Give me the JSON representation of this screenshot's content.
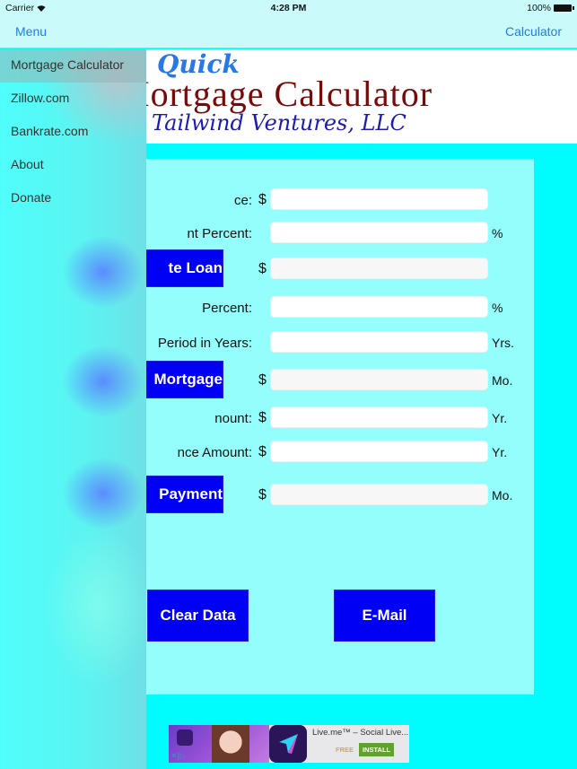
{
  "status_bar": {
    "carrier": "Carrier",
    "time": "4:28 PM",
    "battery": "100%"
  },
  "nav": {
    "left_label": "Menu",
    "right_label": "Calculator"
  },
  "banner": {
    "line1": "Quick",
    "line2": "Mortgage Calculator",
    "line3": "Tailwind Ventures, LLC"
  },
  "menu": {
    "items": [
      {
        "label": "Mortgage Calculator",
        "selected": true
      },
      {
        "label": "Zillow.com",
        "selected": false
      },
      {
        "label": "Bankrate.com",
        "selected": false
      },
      {
        "label": "About",
        "selected": false
      },
      {
        "label": "Donate",
        "selected": false
      }
    ]
  },
  "form": {
    "rows": [
      {
        "label": "ce:",
        "currency": "$",
        "value": "",
        "unit": ""
      },
      {
        "label": "nt Percent:",
        "currency": "",
        "value": "",
        "unit": "%"
      },
      {
        "button": "te Loan",
        "currency": "$",
        "value": "",
        "unit": ""
      },
      {
        "label": "Percent:",
        "currency": "",
        "value": "",
        "unit": "%"
      },
      {
        "label": "Period in Years:",
        "currency": "",
        "value": "",
        "unit": "Yrs."
      },
      {
        "button": "Mortgage",
        "currency": "$",
        "value": "",
        "unit": "Mo."
      },
      {
        "label": "nount:",
        "currency": "$",
        "value": "",
        "unit": "Yr."
      },
      {
        "label": "nce Amount:",
        "currency": "$",
        "value": "",
        "unit": "Yr."
      },
      {
        "button": "Payment",
        "currency": "$",
        "value": "",
        "unit": "Mo."
      }
    ],
    "clear_label": "Clear Data",
    "email_label": "E-Mail"
  },
  "ad": {
    "title": "Live.me™ – Social Live...",
    "price": "FREE",
    "install_label": "INSTALL",
    "close_glyph": "✕|▷"
  },
  "colors": {
    "accent": "#1f7ee8",
    "button_blue": "#0000f5",
    "background": "#00fdfd",
    "panel": "#93fefb"
  }
}
